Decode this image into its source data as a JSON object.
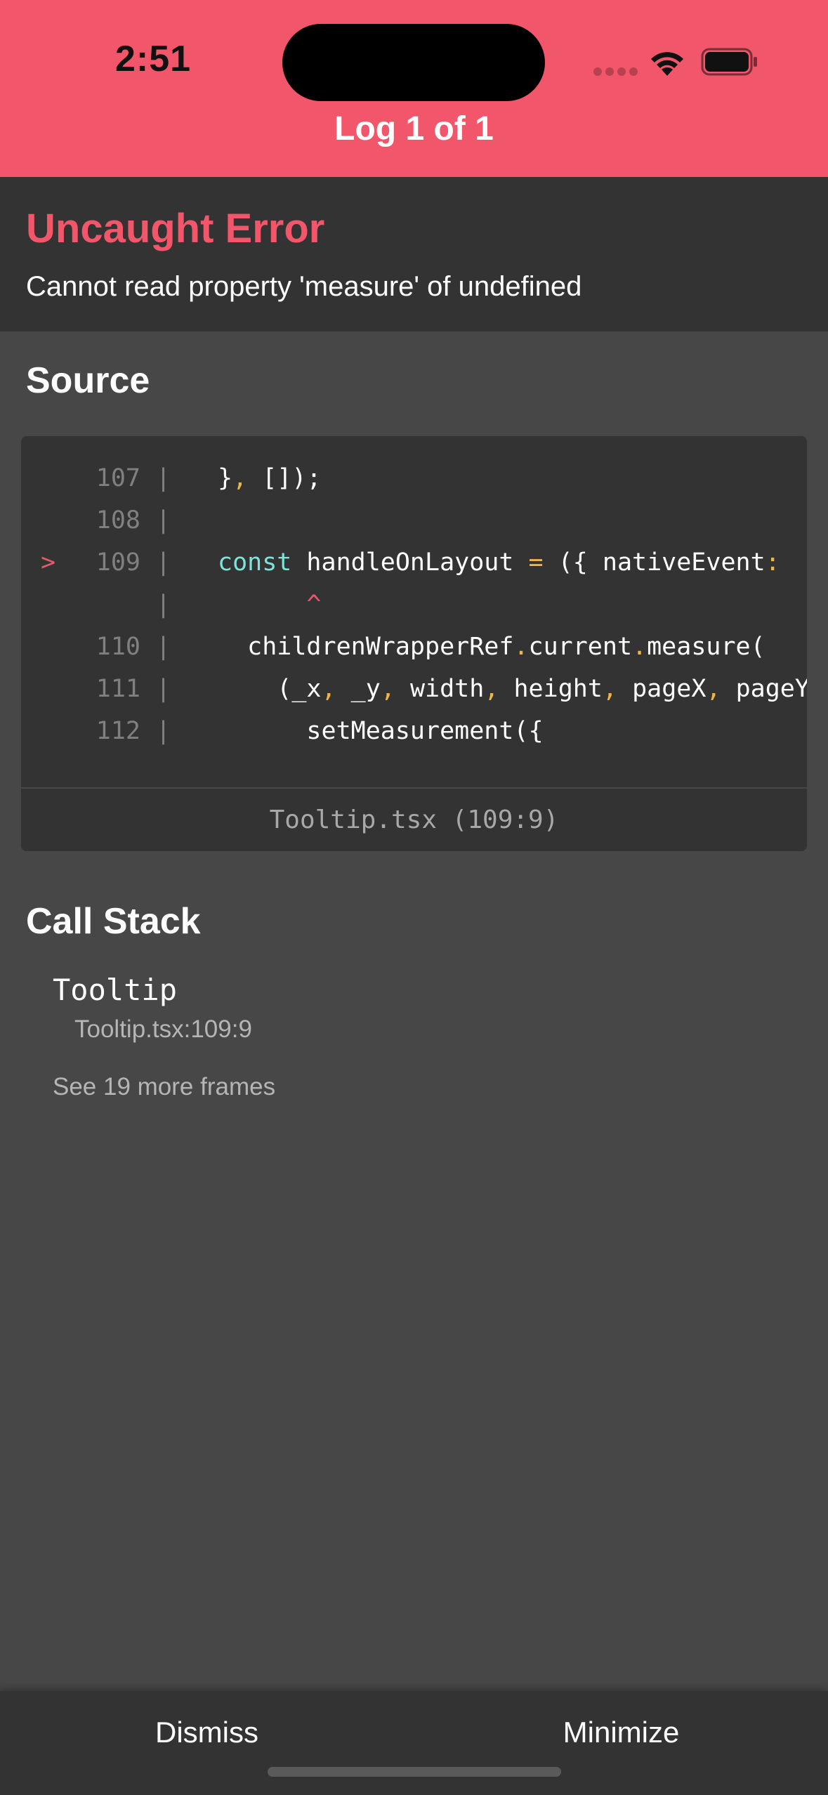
{
  "status_bar": {
    "time": "2:51"
  },
  "header": {
    "title": "Log 1 of 1",
    "background_color": "#f2566a"
  },
  "error": {
    "title": "Uncaught Error",
    "message": "Cannot read property 'measure' of undefined",
    "title_color": "#f2566a"
  },
  "source": {
    "heading": "Source",
    "lines": [
      {
        "marker": "",
        "number": "107",
        "gutter": "|",
        "tokens": [
          {
            "t": "}",
            "c": "plain"
          },
          {
            "t": ",",
            "c": "punct"
          },
          {
            "t": " []);",
            "c": "plain"
          }
        ]
      },
      {
        "marker": "",
        "number": "108",
        "gutter": "|",
        "tokens": []
      },
      {
        "marker": ">",
        "number": "109",
        "gutter": "|",
        "tokens": [
          {
            "t": "const",
            "c": "kw"
          },
          {
            "t": " handleOnLayout ",
            "c": "plain"
          },
          {
            "t": "=",
            "c": "punct"
          },
          {
            "t": " ({ nativeEvent",
            "c": "plain"
          },
          {
            "t": ":",
            "c": "punct"
          }
        ]
      },
      {
        "marker": "",
        "number": "",
        "gutter": "|",
        "tokens": [
          {
            "t": "      ^",
            "c": "caret"
          }
        ]
      },
      {
        "marker": "",
        "number": "110",
        "gutter": "|",
        "tokens": [
          {
            "t": "  childrenWrapperRef",
            "c": "plain"
          },
          {
            "t": ".",
            "c": "punct"
          },
          {
            "t": "current",
            "c": "plain"
          },
          {
            "t": ".",
            "c": "punct"
          },
          {
            "t": "measure(",
            "c": "plain"
          }
        ]
      },
      {
        "marker": "",
        "number": "111",
        "gutter": "|",
        "tokens": [
          {
            "t": "    (_x",
            "c": "plain"
          },
          {
            "t": ",",
            "c": "punct"
          },
          {
            "t": " _y",
            "c": "plain"
          },
          {
            "t": ",",
            "c": "punct"
          },
          {
            "t": " width",
            "c": "plain"
          },
          {
            "t": ",",
            "c": "punct"
          },
          {
            "t": " height",
            "c": "plain"
          },
          {
            "t": ",",
            "c": "punct"
          },
          {
            "t": " pageX",
            "c": "plain"
          },
          {
            "t": ",",
            "c": "punct"
          },
          {
            "t": " pageY",
            "c": "plain"
          }
        ]
      },
      {
        "marker": "",
        "number": "112",
        "gutter": "|",
        "tokens": [
          {
            "t": "      setMeasurement({",
            "c": "plain"
          }
        ]
      }
    ],
    "location": "Tooltip.tsx (109:9)"
  },
  "call_stack": {
    "heading": "Call Stack",
    "frames": [
      {
        "name": "Tooltip",
        "location": "Tooltip.tsx:109:9"
      }
    ],
    "more_frames": "See 19 more frames"
  },
  "bottom_bar": {
    "dismiss_label": "Dismiss",
    "minimize_label": "Minimize"
  },
  "icons": [
    "signal-dots-icon",
    "wifi-icon",
    "battery-icon"
  ],
  "colors": {
    "keyword": "#7ee3d8",
    "punctuation": "#f0b54a",
    "caret": "#e35a6a",
    "line_number": "#808080",
    "panel": "#333333",
    "background": "#474747"
  }
}
